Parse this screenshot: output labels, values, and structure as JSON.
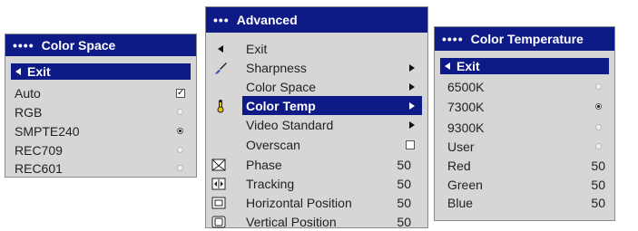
{
  "color_space": {
    "title": "Color Space",
    "title_dots": "••••",
    "exit_label": "Exit",
    "items": [
      {
        "label": "Auto",
        "control": "checkbox",
        "checked": true
      },
      {
        "label": "RGB",
        "control": "radio",
        "selected": false
      },
      {
        "label": "SMPTE240",
        "control": "radio",
        "selected": true
      },
      {
        "label": "REC709",
        "control": "radio",
        "selected": false
      },
      {
        "label": "REC601",
        "control": "radio",
        "selected": false
      }
    ]
  },
  "advanced": {
    "title": "Advanced",
    "title_dots": "•••",
    "items": [
      {
        "label": "Exit",
        "icon": "back-arrow-icon"
      },
      {
        "label": "Sharpness",
        "icon": "brush-icon",
        "submenu": true
      },
      {
        "label": "Color Space",
        "submenu": true
      },
      {
        "label": "Color Temp",
        "icon": "thermometer-icon",
        "submenu": true,
        "selected": true
      },
      {
        "label": "Video Standard",
        "submenu": true
      },
      {
        "label": "Overscan",
        "checkbox": true
      },
      {
        "label": "Phase",
        "icon": "phase-icon",
        "value": "50"
      },
      {
        "label": "Tracking",
        "icon": "tracking-icon",
        "value": "50"
      },
      {
        "label": "Horizontal Position",
        "icon": "horizontal-position-icon",
        "value": "50"
      },
      {
        "label": "Vertical Position",
        "icon": "vertical-position-icon",
        "value": "50"
      }
    ]
  },
  "color_temp": {
    "title": "Color Temperature",
    "title_dots": "••••",
    "exit_label": "Exit",
    "items": [
      {
        "label": "6500K",
        "control": "radio",
        "selected": false
      },
      {
        "label": "7300K",
        "control": "radio",
        "selected": true
      },
      {
        "label": "9300K",
        "control": "radio",
        "selected": false
      },
      {
        "label": "User",
        "control": "radio",
        "selected": false
      },
      {
        "label": "Red",
        "value": "50"
      },
      {
        "label": "Green",
        "value": "50"
      },
      {
        "label": "Blue",
        "value": "50"
      }
    ]
  },
  "colors": {
    "title_bar": "#0e1a86",
    "menu_bg": "#d6d6d6"
  }
}
